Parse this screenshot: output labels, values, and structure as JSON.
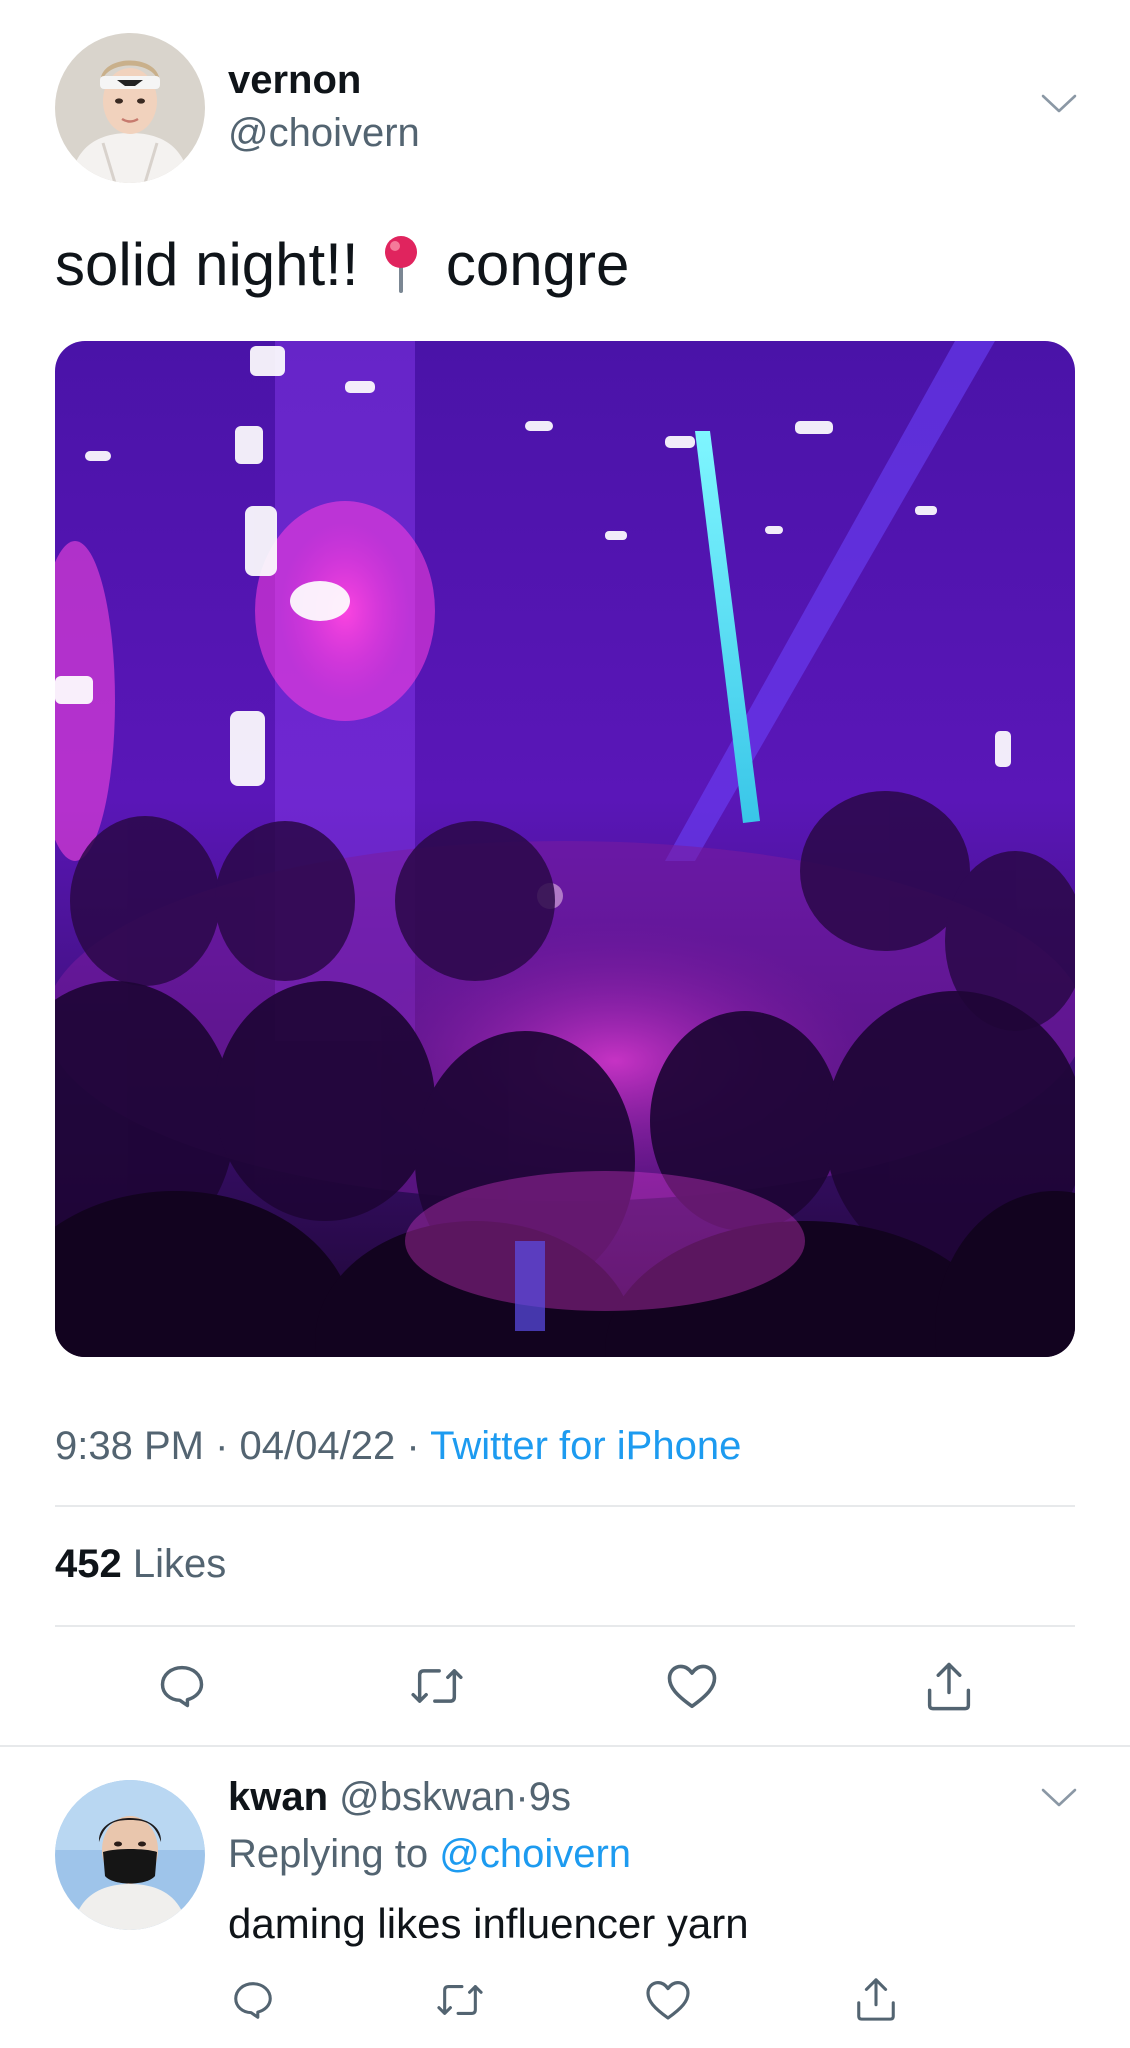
{
  "tweet": {
    "author": {
      "name": "vernon",
      "handle": "@choivern"
    },
    "text_before_icon": "solid night!!",
    "location_icon": "round-pushpin-icon",
    "text_after_icon": "congre",
    "media": {
      "kind": "photo",
      "subject": "nightclub crowd under purple and pink lights"
    },
    "time": "9:38 PM",
    "date": "04/04/22",
    "separator": "·",
    "source": "Twitter for iPhone",
    "likes_count": "452",
    "likes_label": "Likes",
    "actions": [
      "reply-icon",
      "retweet-icon",
      "like-icon",
      "share-icon"
    ]
  },
  "reply": {
    "author": {
      "name": "kwan",
      "handle": "@bskwan"
    },
    "separator": "·",
    "age": "9s",
    "replying_to_label": "Replying to",
    "replying_to_handle": "@choivern",
    "text": "daming likes influencer yarn",
    "actions": [
      "reply-icon",
      "retweet-icon",
      "like-icon",
      "share-icon"
    ]
  },
  "colors": {
    "text_primary": "#0f1419",
    "text_secondary": "#536471",
    "link": "#1d9bf0",
    "divider": "#e7e9eb",
    "icon": "#536471",
    "pin": "#e0245e"
  }
}
